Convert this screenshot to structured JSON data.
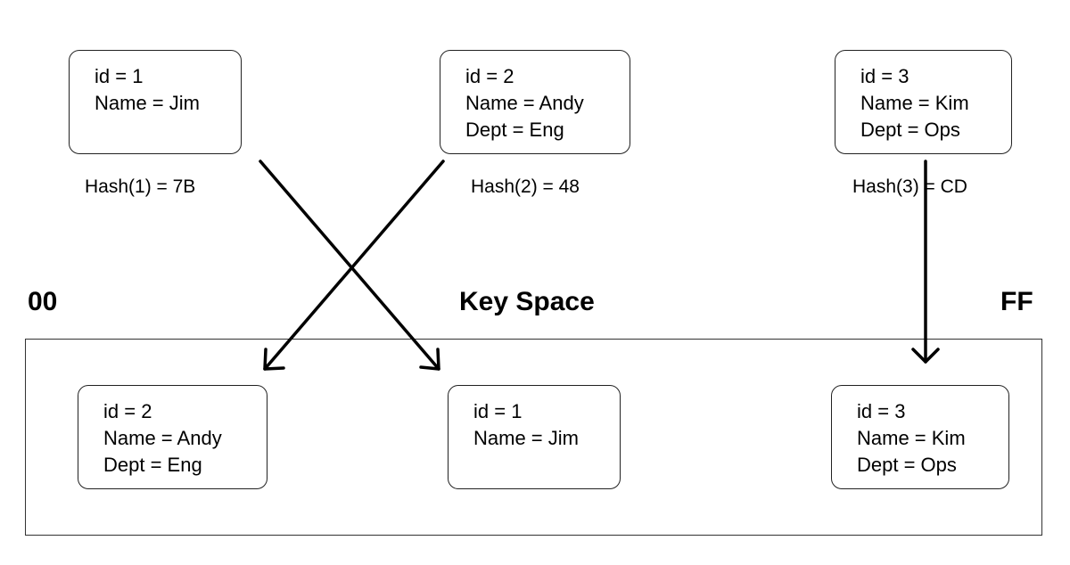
{
  "source_records": [
    {
      "lines": [
        "id = 1",
        "Name = Jim"
      ],
      "hash": "Hash(1) = 7B"
    },
    {
      "lines": [
        "id = 2",
        "Name = Andy",
        "Dept = Eng"
      ],
      "hash": "Hash(2) = 48"
    },
    {
      "lines": [
        "id = 3",
        "Name = Kim",
        "Dept = Ops"
      ],
      "hash": "Hash(3) = CD"
    }
  ],
  "key_space": {
    "start": "00",
    "title": "Key Space",
    "end": "FF"
  },
  "placed_records": [
    {
      "lines": [
        "id = 2",
        "Name = Andy",
        "Dept = Eng"
      ]
    },
    {
      "lines": [
        "id = 1",
        "Name = Jim"
      ]
    },
    {
      "lines": [
        "id = 3",
        "Name = Kim",
        "Dept = Ops"
      ]
    }
  ]
}
